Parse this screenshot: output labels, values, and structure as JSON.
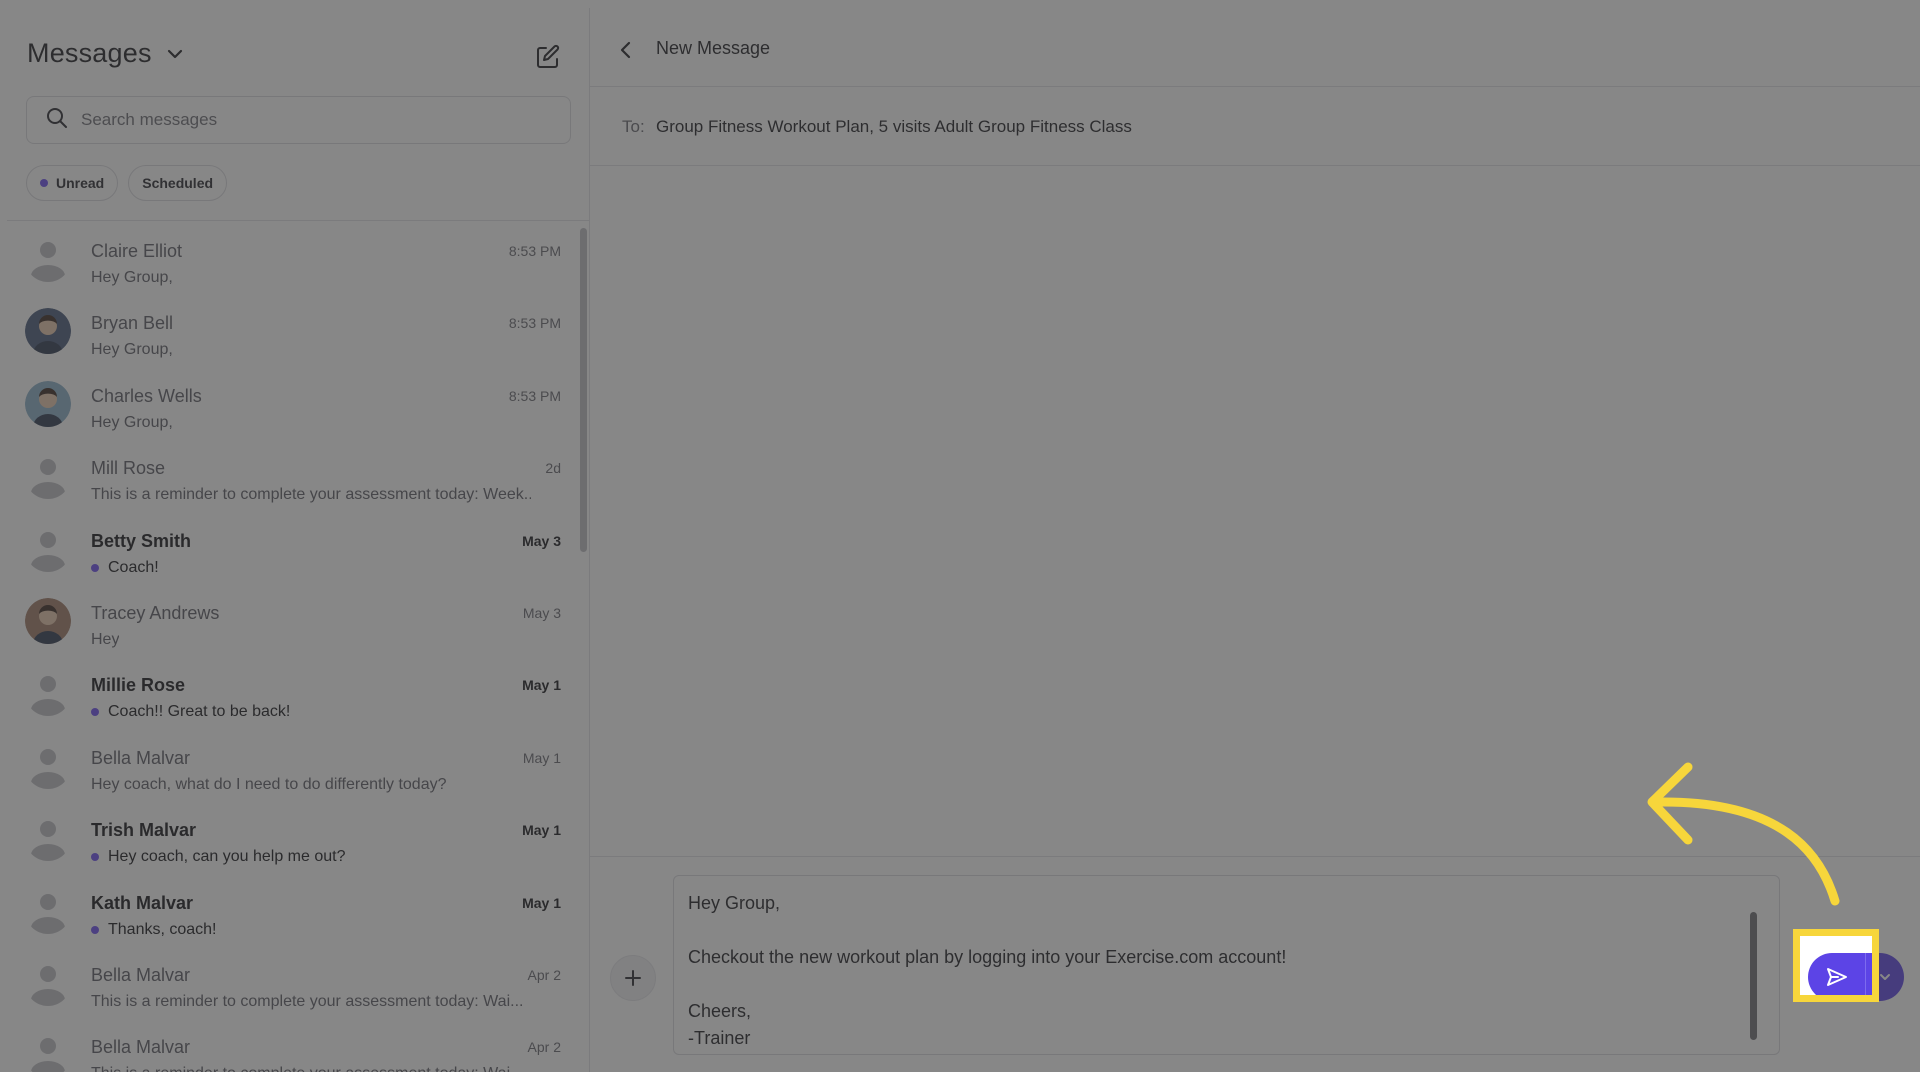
{
  "sidebar": {
    "title": "Messages",
    "search_placeholder": "Search messages",
    "filters": [
      {
        "label": "Unread",
        "has_dot": true
      },
      {
        "label": "Scheduled",
        "has_dot": false
      }
    ],
    "conversations": [
      {
        "name": "Claire Elliot",
        "time": "8:53 PM",
        "snippet": "Hey Group,",
        "unread": false,
        "avatar": "default-avatar-icon"
      },
      {
        "name": "Bryan Bell",
        "time": "8:53 PM",
        "snippet": "Hey Group,",
        "unread": false,
        "avatar": "photo-avatar"
      },
      {
        "name": "Charles Wells",
        "time": "8:53 PM",
        "snippet": "Hey Group,",
        "unread": false,
        "avatar": "photo-avatar"
      },
      {
        "name": "Mill Rose",
        "time": "2d",
        "snippet": "This is a reminder to complete your assessment today: Week...",
        "unread": false,
        "avatar": "default-avatar-icon"
      },
      {
        "name": "Betty Smith",
        "time": "May 3",
        "snippet": "Coach!",
        "unread": true,
        "avatar": "default-avatar-icon"
      },
      {
        "name": "Tracey Andrews",
        "time": "May 3",
        "snippet": "Hey",
        "unread": false,
        "avatar": "photo-avatar"
      },
      {
        "name": "Millie Rose",
        "time": "May 1",
        "snippet": "Coach!! Great to be back!",
        "unread": true,
        "avatar": "default-avatar-icon"
      },
      {
        "name": "Bella Malvar",
        "time": "May 1",
        "snippet": "Hey coach, what do I need to do differently today?",
        "unread": false,
        "avatar": "default-avatar-icon"
      },
      {
        "name": "Trish Malvar",
        "time": "May 1",
        "snippet": "Hey coach, can you help me out?",
        "unread": true,
        "avatar": "default-avatar-icon"
      },
      {
        "name": "Kath Malvar",
        "time": "May 1",
        "snippet": "Thanks, coach!",
        "unread": true,
        "avatar": "default-avatar-icon"
      },
      {
        "name": "Bella Malvar",
        "time": "Apr 2",
        "snippet": "This is a reminder to complete your assessment today: Wai...",
        "unread": false,
        "avatar": "default-avatar-icon"
      },
      {
        "name": "Bella Malvar",
        "time": "Apr 2",
        "snippet": "This is a reminder to complete your assessment today: Wai...",
        "unread": false,
        "avatar": "default-avatar-icon"
      }
    ]
  },
  "main": {
    "title": "New Message",
    "to_label": "To:",
    "to_value": "Group Fitness Workout Plan, 5 visits Adult Group Fitness Class",
    "message_lines": [
      "Hey Group,",
      "",
      "Checkout the new workout plan by logging into your Exercise.com account!",
      "",
      "Cheers,",
      "-Trainer"
    ]
  },
  "colors": {
    "accent": "#5c44e6",
    "unread_dot": "#6d4ff0",
    "highlight": "#f7d63b",
    "overlay": "#3c3c3c"
  }
}
